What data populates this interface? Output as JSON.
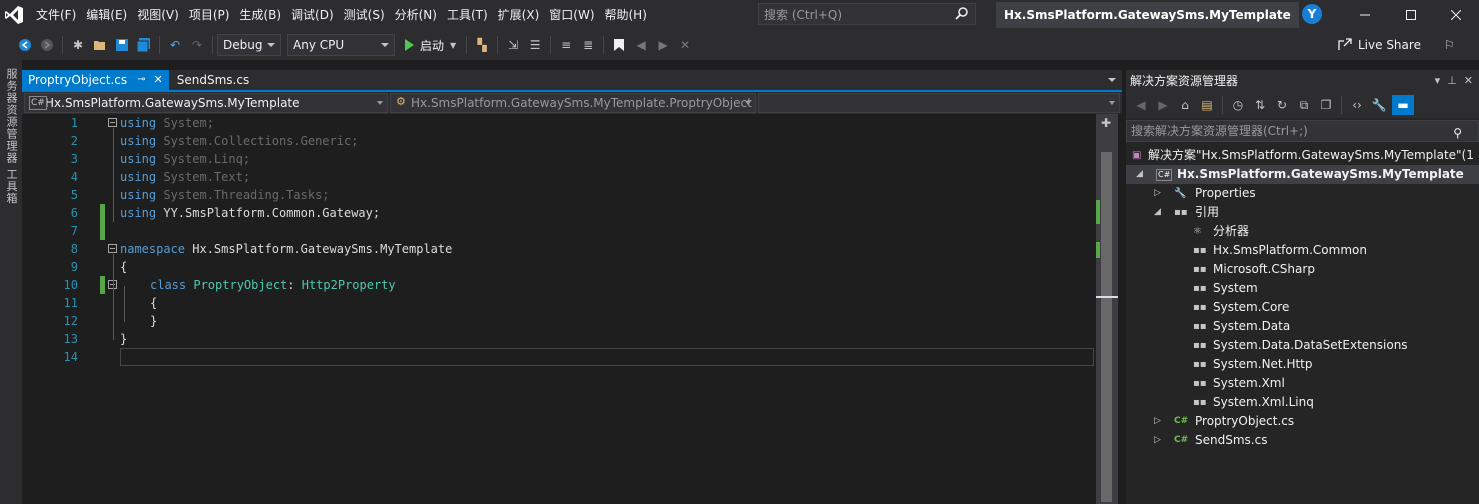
{
  "menu": [
    "文件(F)",
    "编辑(E)",
    "视图(V)",
    "项目(P)",
    "生成(B)",
    "调试(D)",
    "测试(S)",
    "分析(N)",
    "工具(T)",
    "扩展(X)",
    "窗口(W)",
    "帮助(H)"
  ],
  "search": {
    "placeholder": "搜索 (Ctrl+Q)"
  },
  "window_title": "Hx.SmsPlatform.GatewaySms.MyTemplate",
  "user_initial": "Y",
  "toolbar": {
    "config": "Debug",
    "platform": "Any CPU",
    "start_label": "启动",
    "live_share": "Live Share"
  },
  "left_strip": "服务器资源管理器  工具箱",
  "tabs": [
    {
      "label": "ProptryObject.cs",
      "active": true
    },
    {
      "label": "SendSms.cs",
      "active": false
    }
  ],
  "navbar": {
    "project": "Hx.SmsPlatform.GatewaySms.MyTemplate",
    "type": "Hx.SmsPlatform.GatewaySms.MyTemplate.ProptryObject"
  },
  "code_lines": [
    {
      "n": "1",
      "text": "using System;"
    },
    {
      "n": "2",
      "text": "using System.Collections.Generic;"
    },
    {
      "n": "3",
      "text": "using System.Linq;"
    },
    {
      "n": "4",
      "text": "using System.Text;"
    },
    {
      "n": "5",
      "text": "using System.Threading.Tasks;"
    },
    {
      "n": "6",
      "text": "using YY.SmsPlatform.Common.Gateway;"
    },
    {
      "n": "7",
      "text": ""
    },
    {
      "n": "8",
      "text": "namespace Hx.SmsPlatform.GatewaySms.MyTemplate"
    },
    {
      "n": "9",
      "text": "{"
    },
    {
      "n": "10",
      "text": "class ProptryObject: Http2Property"
    },
    {
      "n": "11",
      "text": "{"
    },
    {
      "n": "12",
      "text": "}"
    },
    {
      "n": "13",
      "text": "}"
    },
    {
      "n": "14",
      "text": ""
    }
  ],
  "solution_explorer": {
    "title": "解决方案资源管理器",
    "search_placeholder": "搜索解决方案资源管理器(Ctrl+;)",
    "solution": "解决方案\"Hx.SmsPlatform.GatewaySms.MyTemplate\"(1",
    "project": "Hx.SmsPlatform.GatewaySms.MyTemplate",
    "properties": "Properties",
    "references": "引用",
    "analyzer": "分析器",
    "refs": [
      "Hx.SmsPlatform.Common",
      "Microsoft.CSharp",
      "System",
      "System.Core",
      "System.Data",
      "System.Data.DataSetExtensions",
      "System.Net.Http",
      "System.Xml",
      "System.Xml.Linq"
    ],
    "files": [
      "ProptryObject.cs",
      "SendSms.cs"
    ]
  },
  "colors": {
    "accent": "#007acc",
    "keyword": "#569cd6",
    "type": "#4ec9b0",
    "line_number": "#2b91af",
    "change_marker": "#57a64a"
  }
}
